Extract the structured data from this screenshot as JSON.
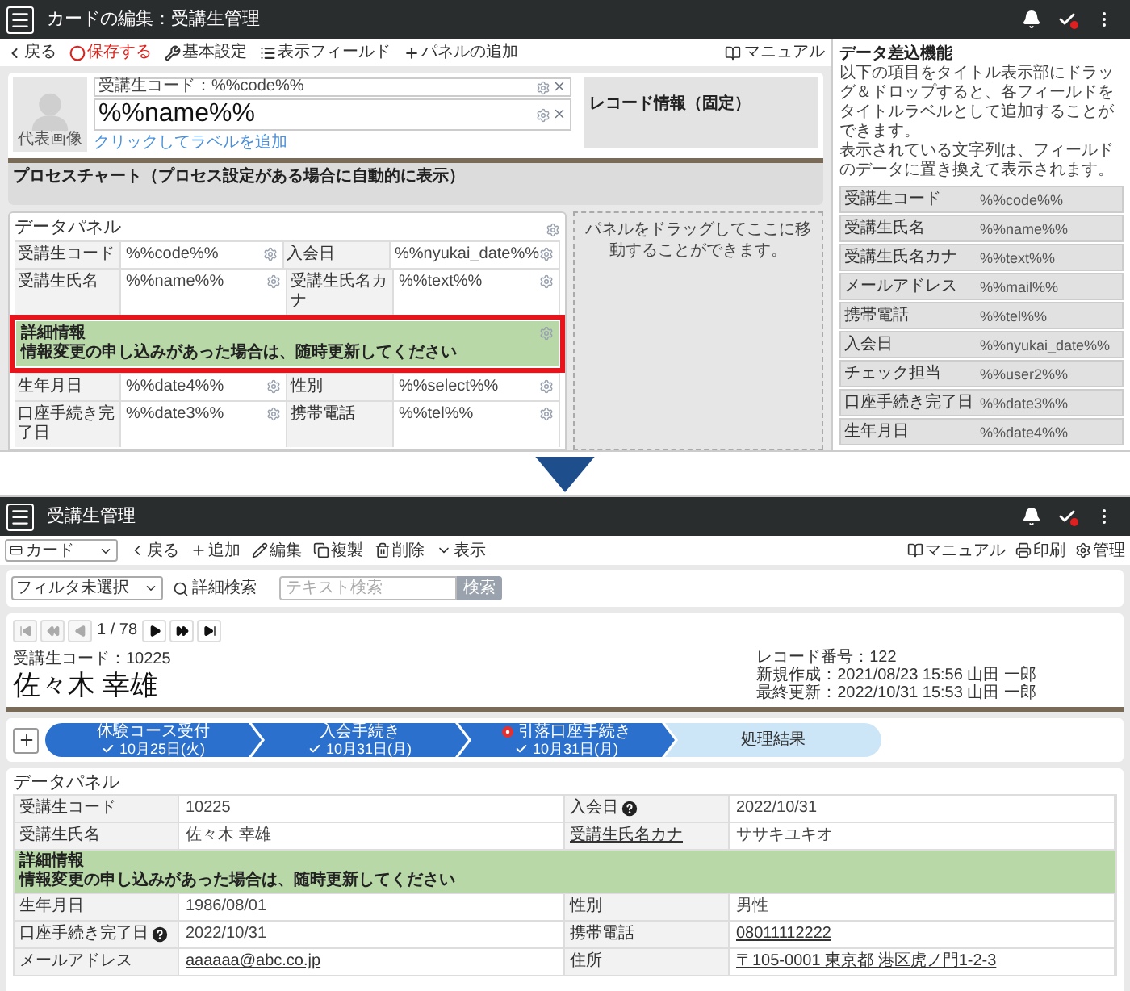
{
  "top": {
    "app_bar": {
      "title": "カードの編集：受講生管理"
    },
    "toolbar": [
      {
        "kind": "back",
        "label": "戻る"
      },
      {
        "kind": "save",
        "label": "保存する"
      },
      {
        "kind": "settings",
        "label": "基本設定"
      },
      {
        "kind": "fields",
        "label": "表示フィールド"
      },
      {
        "kind": "add",
        "label": "パネルの追加"
      }
    ],
    "manual": "マニュアル",
    "card": {
      "avatar_label": "代表画像",
      "code_field": "受講生コード：%%code%%",
      "name_field": "%%name%%",
      "add_label_link": "クリックしてラベルを追加",
      "record_info_title": "レコード情報（固定）"
    },
    "process_chart_title": "プロセスチャート（プロセス設定がある場合に自動的に表示）",
    "data_panel": {
      "title": "データパネル",
      "rows": [
        {
          "kind": "pair",
          "cells": [
            {
              "label": "受講生コード",
              "value": "%%code%%"
            },
            {
              "label": "入会日",
              "value": "%%nyukai_date%%"
            }
          ]
        },
        {
          "kind": "pair",
          "cells": [
            {
              "label": "受講生氏名",
              "value": "%%name%%"
            },
            {
              "label": "受講生氏名カナ",
              "value": "%%text%%"
            }
          ]
        },
        {
          "kind": "note",
          "title": "詳細情報",
          "text": "情報変更の申し込みがあった場合は、随時更新してください",
          "highlighted": true
        },
        {
          "kind": "pair",
          "cells": [
            {
              "label": "生年月日",
              "value": "%%date4%%"
            },
            {
              "label": "性別",
              "value": "%%select%%"
            }
          ]
        },
        {
          "kind": "pair",
          "cells": [
            {
              "label": "口座手続き完了日",
              "value": "%%date3%%"
            },
            {
              "label": "携帯電話",
              "value": "%%tel%%"
            }
          ]
        }
      ]
    },
    "drop_zone": "パネルをドラッグしてここに移動することができます。",
    "sidebar": {
      "title": "データ差込機能",
      "description": [
        "以下の項目をタイトル表示部にドラッグ＆ドロップすると、各フィールドをタイトルラベルとして追加することができます。",
        "表示されている文字列は、フィールドのデータに置き換えて表示されます。"
      ],
      "fields": [
        {
          "label": "受講生コード",
          "value": "%%code%%"
        },
        {
          "label": "受講生氏名",
          "value": "%%name%%"
        },
        {
          "label": "受講生氏名カナ",
          "value": "%%text%%"
        },
        {
          "label": "メールアドレス",
          "value": "%%mail%%"
        },
        {
          "label": "携帯電話",
          "value": "%%tel%%"
        },
        {
          "label": "入会日",
          "value": "%%nyukai_date%%"
        },
        {
          "label": "チェック担当",
          "value": "%%user2%%"
        },
        {
          "label": "口座手続き完了日",
          "value": "%%date3%%"
        },
        {
          "label": "生年月日",
          "value": "%%date4%%"
        }
      ]
    }
  },
  "bottom": {
    "app_bar": {
      "title": "受講生管理"
    },
    "view_select": "カード",
    "toolbar": [
      {
        "kind": "back",
        "label": "戻る"
      },
      {
        "kind": "add",
        "label": "追加"
      },
      {
        "kind": "edit",
        "label": "編集"
      },
      {
        "kind": "copy",
        "label": "複製"
      },
      {
        "kind": "delete",
        "label": "削除"
      },
      {
        "kind": "view",
        "label": "表示"
      }
    ],
    "toolbar_right": [
      {
        "kind": "manual",
        "label": "マニュアル"
      },
      {
        "kind": "print",
        "label": "印刷"
      },
      {
        "kind": "manage",
        "label": "管理"
      }
    ],
    "filter_select": "フィルタ未選択",
    "detail_search": "詳細検索",
    "search": {
      "placeholder": "テキスト検索",
      "button": "検索"
    },
    "nav": {
      "position": "1 / 78",
      "buttons": [
        {
          "kind": "first",
          "disabled": true
        },
        {
          "kind": "prev_many",
          "disabled": true
        },
        {
          "kind": "prev",
          "disabled": true
        },
        {
          "kind": "next",
          "disabled": false
        },
        {
          "kind": "next_many",
          "disabled": false
        },
        {
          "kind": "last",
          "disabled": false
        }
      ]
    },
    "record": {
      "code": "受講生コード：10225",
      "name": "佐々木 幸雄",
      "info": [
        "レコード番号：122",
        "新規作成：2021/08/23 15:56 山田 一郎",
        "最終更新：2022/10/31 15:53 山田 一郎"
      ]
    },
    "process": [
      {
        "name": "体験コース受付",
        "date": "10月25日(火)",
        "done": true,
        "alert": false
      },
      {
        "name": "入会手続き",
        "date": "10月31日(月)",
        "done": true,
        "alert": false
      },
      {
        "name": "引落口座手続き",
        "date": "10月31日(月)",
        "done": true,
        "alert": true
      },
      {
        "name": "処理結果",
        "done": false,
        "alert": false
      }
    ],
    "data_panel": {
      "title": "データパネル",
      "rows": [
        {
          "kind": "pair",
          "cells": [
            {
              "label": "受講生コード",
              "value": "10225",
              "help": false,
              "link": false,
              "label_link": false
            },
            {
              "label": "入会日",
              "value": "2022/10/31",
              "help": true,
              "link": false,
              "label_link": false
            }
          ]
        },
        {
          "kind": "pair",
          "cells": [
            {
              "label": "受講生氏名",
              "value": "佐々木 幸雄",
              "help": false,
              "link": false,
              "label_link": false
            },
            {
              "label": "受講生氏名カナ",
              "value": "ササキユキオ",
              "help": false,
              "link": false,
              "label_link": true
            }
          ]
        },
        {
          "kind": "note",
          "title": "詳細情報",
          "text": "情報変更の申し込みがあった場合は、随時更新してください",
          "highlighted": false
        },
        {
          "kind": "pair",
          "cells": [
            {
              "label": "生年月日",
              "value": "1986/08/01",
              "help": false,
              "link": false,
              "label_link": false
            },
            {
              "label": "性別",
              "value": "男性",
              "help": false,
              "link": false,
              "label_link": false
            }
          ]
        },
        {
          "kind": "pair",
          "cells": [
            {
              "label": "口座手続き完了日",
              "value": "2022/10/31",
              "help": true,
              "link": false,
              "label_link": false
            },
            {
              "label": "携帯電話",
              "value": "08011112222",
              "help": false,
              "link": true,
              "label_link": false
            }
          ]
        },
        {
          "kind": "pair",
          "cells": [
            {
              "label": "メールアドレス",
              "value": "aaaaaa@abc.co.jp",
              "help": false,
              "link": true,
              "label_link": false
            },
            {
              "label": "住所",
              "value": "〒105-0001 東京都 港区虎ノ門1-2-3",
              "help": false,
              "link": true,
              "label_link": false
            }
          ]
        }
      ]
    }
  }
}
